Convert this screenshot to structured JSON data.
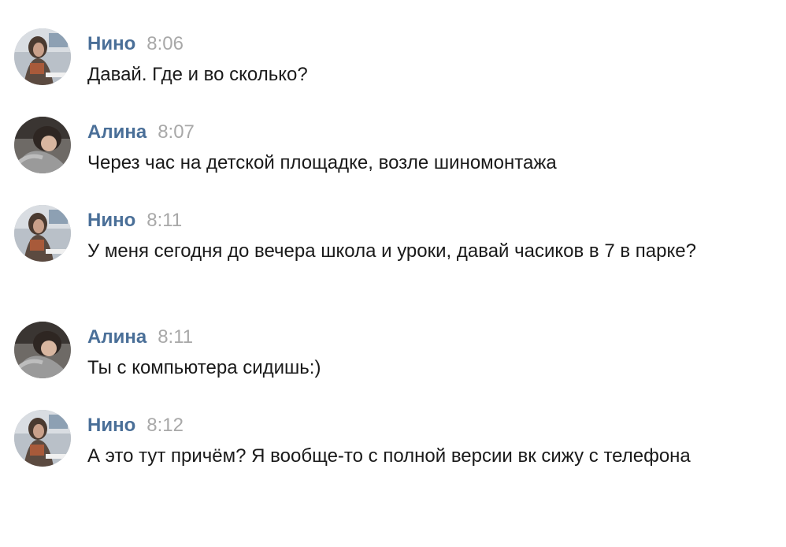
{
  "conversation": {
    "messages": [
      {
        "author": "Нино",
        "time": "8:06",
        "text": "Давай. Где и во сколько?",
        "avatar": "avatar-nino",
        "author_color": "#4a6f98"
      },
      {
        "author": "Алина",
        "time": "8:07",
        "text": "Через час на детской площадке, возле шиномонтажа",
        "avatar": "avatar-alina",
        "author_color": "#4a6f98"
      },
      {
        "author": "Нино",
        "time": "8:11",
        "text": "У меня сегодня до вечера школа и уроки, давай часиков в 7 в парке?",
        "avatar": "avatar-nino",
        "author_color": "#4a6f98"
      },
      {
        "author": "Алина",
        "time": "8:11",
        "text": "Ты с компьютера сидишь:)",
        "avatar": "avatar-alina",
        "author_color": "#4a6f98"
      },
      {
        "author": "Нино",
        "time": "8:12",
        "text": "А это тут причём? Я вообще-то с полной версии вк сижу с телефона",
        "avatar": "avatar-nino",
        "author_color": "#4a6f98"
      }
    ]
  }
}
